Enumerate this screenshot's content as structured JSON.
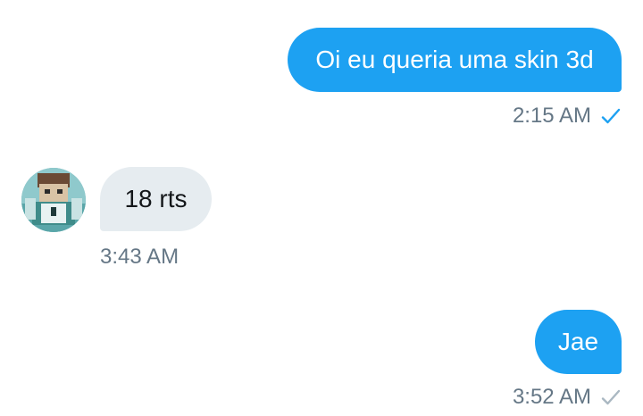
{
  "conversation": {
    "messages": [
      {
        "text": "Oi eu queria uma skin 3d",
        "time": "2:15 AM",
        "direction": "sent",
        "status_icon": "check-read-icon",
        "status_color": "#1da1f2"
      },
      {
        "text": "18 rts",
        "time": "3:43 AM",
        "direction": "received",
        "avatar_icon": "user-avatar-minecraft-skin"
      },
      {
        "text": "Jae",
        "time": "3:52 AM",
        "direction": "sent",
        "status_icon": "check-sent-icon",
        "status_color": "#aab8c2"
      }
    ]
  },
  "colors": {
    "sent_bubble": "#1da1f2",
    "received_bubble": "#e6ecf0",
    "timestamp": "#657786"
  }
}
